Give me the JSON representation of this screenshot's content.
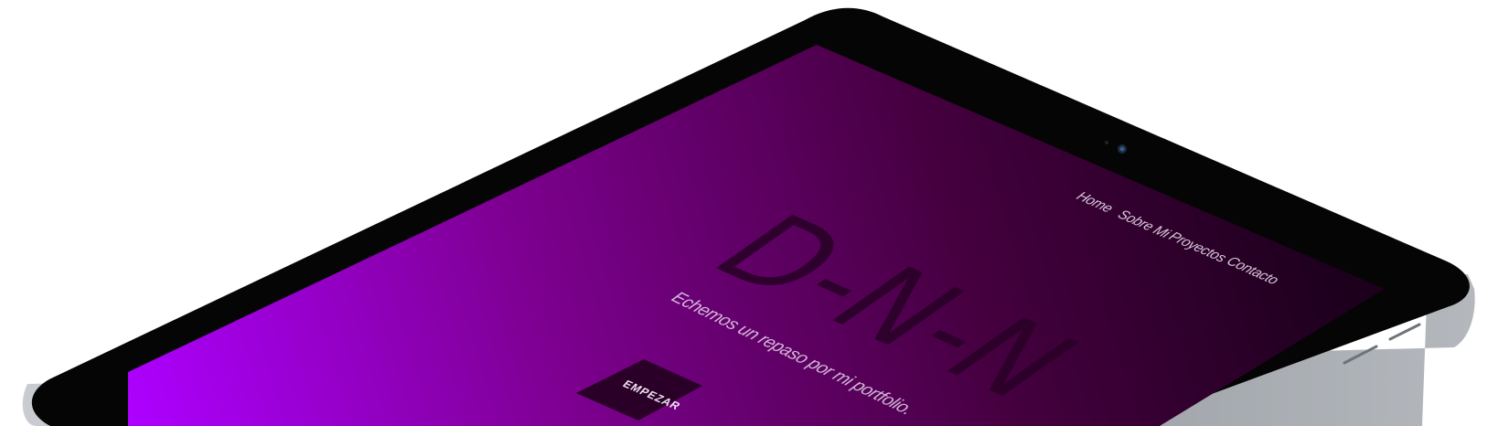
{
  "nav": {
    "items": [
      {
        "label": "Home"
      },
      {
        "label": "Sobre Mi"
      },
      {
        "label": "Proyectos"
      },
      {
        "label": "Contacto"
      }
    ]
  },
  "hero": {
    "logo": "D-N-N",
    "tagline": "Echemos un repaso por mi portfolio.",
    "cta_label": "EMPEZAR"
  },
  "colors": {
    "gradient_bright": "#a800f0",
    "gradient_dark": "#1e0020",
    "bezel": "#050505",
    "frame": "#9aa0a6"
  }
}
